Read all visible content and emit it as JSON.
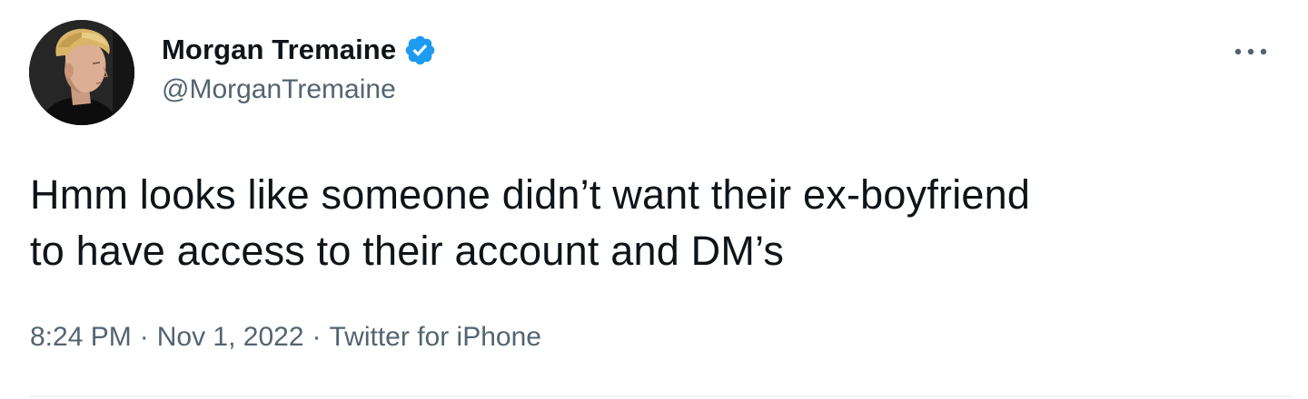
{
  "tweet": {
    "author": {
      "display_name": "Morgan Tremaine",
      "handle": "@MorganTremaine",
      "verified": true,
      "avatar_icon": "profile-photo"
    },
    "text_lines": [
      "Hmm looks like someone didn’t want their ex-boyfriend",
      "to have access to their account and DM’s"
    ],
    "meta": {
      "time": "8:24 PM",
      "separator": "·",
      "date": "Nov 1, 2022",
      "source": "Twitter for iPhone"
    },
    "more_icon": "more-options-icon"
  },
  "colors": {
    "text_primary": "#0f1419",
    "text_secondary": "#536471",
    "verified_blue": "#1d9bf0",
    "divider": "#eff3f4"
  }
}
